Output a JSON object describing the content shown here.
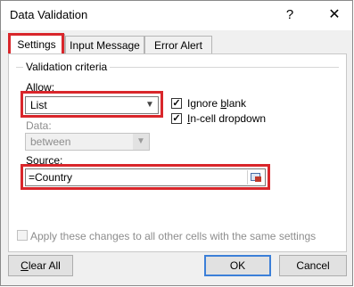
{
  "window": {
    "title": "Data Validation",
    "help_glyph": "?",
    "close_glyph": "✕"
  },
  "tabs": [
    {
      "label": "Settings",
      "selected": true
    },
    {
      "label": "Input Message",
      "selected": false
    },
    {
      "label": "Error Alert",
      "selected": false
    }
  ],
  "criteria": {
    "group_label": "Validation criteria",
    "allow_label_pre": "Allo",
    "allow_label_key": "w",
    "allow_label_post": ":",
    "allow_value": "List",
    "data_label": "Data:",
    "data_value": "between",
    "ignore_blank": {
      "pre": "Ignore ",
      "key": "b",
      "post": "lank",
      "checked": true
    },
    "in_cell_dropdown": {
      "pre": "",
      "key": "I",
      "post": "n-cell dropdown",
      "checked": true
    },
    "source_label_pre": "",
    "source_label_key": "S",
    "source_label_post": "ource:",
    "source_value": "=Country"
  },
  "apply_all": {
    "label": "Apply these changes to all other cells with the same settings",
    "checked": false,
    "enabled": false
  },
  "buttons": {
    "clear_pre": "",
    "clear_key": "C",
    "clear_post": "lear All",
    "ok": "OK",
    "cancel": "Cancel"
  },
  "colors": {
    "highlight": "#d9262b",
    "ok_border": "#3c7fd8"
  }
}
